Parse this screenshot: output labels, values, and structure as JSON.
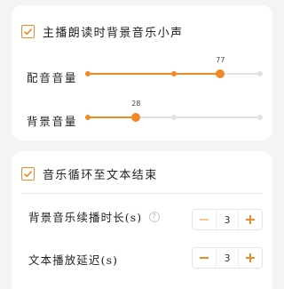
{
  "colors": {
    "accent": "#ef8a24",
    "accent_light": "#f7c698",
    "track": "#e2e2e2"
  },
  "anchor_reading": {
    "checkbox_checked": true,
    "label": "主播朗读时背景音乐小声",
    "dubbing_volume": {
      "label": "配音音量",
      "value": 77,
      "tick_positions_pct": [
        0,
        50,
        77,
        100
      ]
    },
    "bgm_volume": {
      "label": "背景音量",
      "value": 28,
      "tick_positions_pct": [
        0,
        28,
        50,
        100
      ]
    }
  },
  "music_loop": {
    "checkbox_checked": true,
    "label": "音乐循环至文本结束",
    "bgm_duration": {
      "label": "背景音乐续播时长(s)",
      "help_icon": "?",
      "value": "3",
      "minus_disabled": true
    },
    "playback_delay": {
      "label": "文本播放延迟(s)",
      "value": "3",
      "minus_disabled": false
    }
  }
}
